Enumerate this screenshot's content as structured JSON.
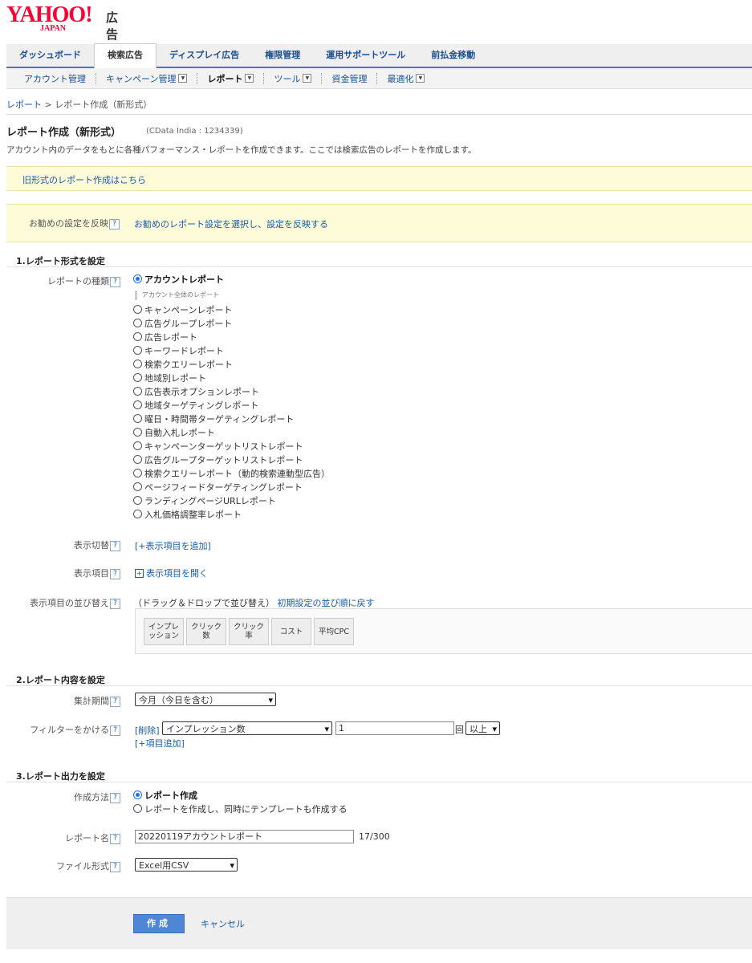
{
  "logo": {
    "yahoo": "YAHOO!",
    "japan": "JAPAN",
    "ad": "広告"
  },
  "tabs": [
    {
      "label": "ダッシュボード"
    },
    {
      "label": "検索広告"
    },
    {
      "label": "ディスプレイ広告"
    },
    {
      "label": "権限管理"
    },
    {
      "label": "運用サポートツール"
    },
    {
      "label": "前払金移動"
    }
  ],
  "subnav": [
    {
      "label": "アカウント管理"
    },
    {
      "label": "キャンペーン管理"
    },
    {
      "label": "レポート"
    },
    {
      "label": "ツール"
    },
    {
      "label": "資金管理"
    },
    {
      "label": "最適化"
    }
  ],
  "breadcrumb": {
    "parent": "レポート",
    "sep": " > ",
    "current": "レポート作成（新形式）"
  },
  "page": {
    "title": "レポート作成（新形式）",
    "account": "(CData India : 1234339)",
    "description": "アカウント内のデータをもとに各種パフォーマンス・レポートを作成できます。ここでは検索広告のレポートを作成します。"
  },
  "old_format_link": "旧形式のレポート作成はこちら",
  "recommend": {
    "label": "お勧めの設定を反映",
    "link": "お勧めのレポート設定を選択し、設定を反映する"
  },
  "help": "?",
  "section1": {
    "title": "1.レポート形式を設定",
    "type_label": "レポートの種類",
    "selected": "アカウントレポート",
    "selected_note": "アカウント全体のレポート",
    "options": [
      "キャンペーンレポート",
      "広告グループレポート",
      "広告レポート",
      "キーワードレポート",
      "検索クエリーレポート",
      "地域別レポート",
      "広告表示オプションレポート",
      "地域ターゲティングレポート",
      "曜日・時間帯ターゲティングレポート",
      "自動入札レポート",
      "キャンペーンターゲットリストレポート",
      "広告グループターゲットリストレポート",
      "検索クエリーレポート（動的検索連動型広告）",
      "ページフィードターゲティングレポート",
      "ランディングページURLレポート",
      "入札価格調整率レポート"
    ],
    "toggle_label": "表示切替",
    "toggle_link": "[+表示項目を追加]",
    "items_label": "表示項目",
    "items_link": "表示項目を開く",
    "order_label": "表示項目の並び替え",
    "order_hint": "（ドラッグ＆ドロップで並び替え）",
    "order_reset": "初期設定の並び順に戻す",
    "chips": [
      {
        "l1": "インプレ",
        "l2": "ッション"
      },
      {
        "l1": "クリック",
        "l2": "数"
      },
      {
        "l1": "クリック",
        "l2": "率"
      },
      {
        "l1": "コスト",
        "l2": ""
      },
      {
        "l1": "平均CPC",
        "l2": ""
      }
    ]
  },
  "section2": {
    "title": "2.レポート内容を設定",
    "period_label": "集計期間",
    "period_value": "今月（今日を含む）",
    "filter_label": "フィルターをかける",
    "filter_delete": "[削除]",
    "filter_field": "インプレッション数",
    "filter_value": "1",
    "filter_unit": "回",
    "filter_op": "以上",
    "filter_add": "[+項目追加]"
  },
  "section3": {
    "title": "3.レポート出力を設定",
    "method_label": "作成方法",
    "method_selected": "レポート作成",
    "method_other": "レポートを作成し、同時にテンプレートも作成する",
    "name_label": "レポート名",
    "name_value": "20220119アカウントレポート",
    "name_count": "17/300",
    "format_label": "ファイル形式",
    "format_value": "Excel用CSV"
  },
  "footer": {
    "create": "作成",
    "cancel": "キャンセル"
  },
  "colors": {
    "brand": "#ff0033",
    "link": "#1a5aa8",
    "tab_border": "#4177c4",
    "notice_bg": "#fdfbd8",
    "primary_button": "#4f86d6"
  }
}
